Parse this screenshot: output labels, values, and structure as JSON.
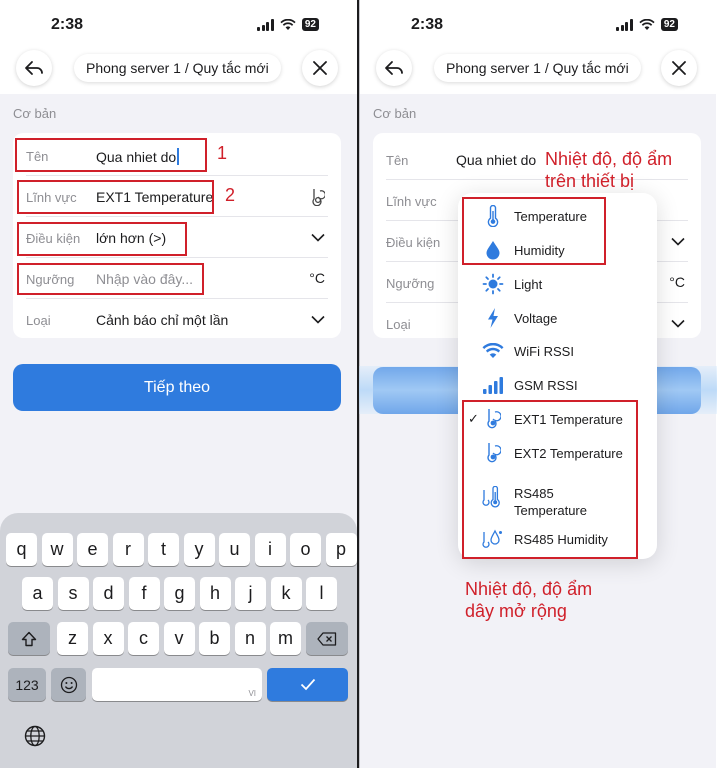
{
  "status": {
    "time": "2:38",
    "battery": "92"
  },
  "navbar": {
    "title": "Phong server 1 / Quy tắc mới"
  },
  "form": {
    "section_label": "Cơ bản",
    "name": {
      "label": "Tên",
      "value": "Qua nhiet do"
    },
    "field": {
      "label": "Lĩnh vực",
      "value": "EXT1 Temperature"
    },
    "condition": {
      "label": "Điều kiện",
      "value": "lớn hơn (>)"
    },
    "threshold": {
      "label": "Ngưỡng",
      "placeholder": "Nhập vào đây...",
      "unit": "°C"
    },
    "type": {
      "label": "Loại",
      "value": "Cảnh báo chỉ một lần"
    }
  },
  "next_button": "Tiếp theo",
  "annotations": {
    "marker_1": "1",
    "marker_2": "2",
    "onboard_line1": "Nhiệt độ, độ ẩm",
    "onboard_line2": "trên thiết bị",
    "ext_line1": "Nhiệt độ, độ ẩm",
    "ext_line2": "dây mở rộng"
  },
  "keyboard": {
    "row1": [
      "q",
      "w",
      "e",
      "r",
      "t",
      "y",
      "u",
      "i",
      "o",
      "p"
    ],
    "row2": [
      "a",
      "s",
      "d",
      "f",
      "g",
      "h",
      "j",
      "k",
      "l"
    ],
    "row3": [
      "z",
      "x",
      "c",
      "v",
      "b",
      "n",
      "m"
    ],
    "numbers_key": "123",
    "space_hint": "VI"
  },
  "dropdown": {
    "items": [
      {
        "label": "Temperature",
        "icon": "thermometer-icon"
      },
      {
        "label": "Humidity",
        "icon": "water-drop-icon"
      },
      {
        "label": "Light",
        "icon": "sun-icon"
      },
      {
        "label": "Voltage",
        "icon": "bolt-icon"
      },
      {
        "label": "WiFi RSSI",
        "icon": "wifi-icon"
      },
      {
        "label": "GSM RSSI",
        "icon": "cell-signal-icon"
      },
      {
        "label": "EXT1 Temperature",
        "icon": "probe-icon",
        "selected": true
      },
      {
        "label": "EXT2 Temperature",
        "icon": "probe-icon"
      },
      {
        "label": "RS485 Temperature",
        "icon": "rs485-temp-icon"
      },
      {
        "label": "RS485 Humidity",
        "icon": "rs485-humidity-icon"
      }
    ],
    "check_mark": "✓"
  },
  "colors": {
    "accent": "#2f7bde",
    "annotation_red": "#d0202a",
    "icon_blue": "#2f7bde"
  }
}
